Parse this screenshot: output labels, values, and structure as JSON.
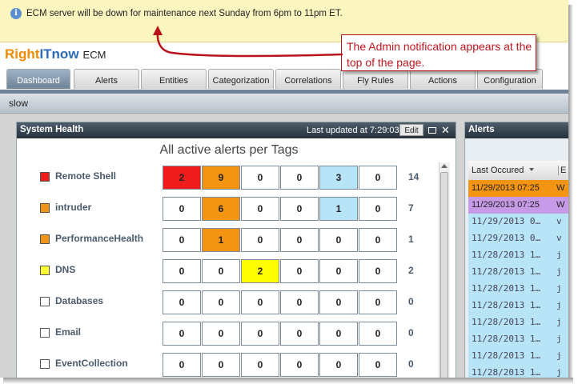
{
  "notification": {
    "message": "ECM server will be down for maintenance next Sunday from 6pm to 11pm ET."
  },
  "app": {
    "logo_part1": "Right",
    "logo_part2": "ITnow",
    "product": "ECM"
  },
  "tabs": [
    {
      "label": "Dashboard",
      "active": true
    },
    {
      "label": "Alerts"
    },
    {
      "label": "Entities"
    },
    {
      "label": "Categorization"
    },
    {
      "label": "Correlations"
    },
    {
      "label": "Fly Rules"
    },
    {
      "label": "Actions"
    },
    {
      "label": "Configuration"
    }
  ],
  "subbar": {
    "label": "slow"
  },
  "system_health": {
    "title": "System Health",
    "last_updated": "Last updated at 7:29:03",
    "edit_label": "Edit",
    "close_glyph": "✕",
    "chart_title": "All active alerts per Tags",
    "rows": [
      {
        "tag": "Remote Shell",
        "color": "#ee1c1c",
        "cells": [
          "2",
          "9",
          "0",
          "0",
          "3",
          "0"
        ],
        "total": "14"
      },
      {
        "tag": "intruder",
        "color": "#f39412",
        "cells": [
          "0",
          "6",
          "0",
          "0",
          "1",
          "0"
        ],
        "total": "7"
      },
      {
        "tag": "PerformanceHealth",
        "color": "#f39412",
        "cells": [
          "0",
          "1",
          "0",
          "0",
          "0",
          "0"
        ],
        "total": "1"
      },
      {
        "tag": "DNS",
        "color": "#ffff33",
        "cells": [
          "0",
          "0",
          "2",
          "0",
          "0",
          "0"
        ],
        "total": "2"
      },
      {
        "tag": "Databases",
        "color": "#ffffff",
        "cells": [
          "0",
          "0",
          "0",
          "0",
          "0",
          "0"
        ],
        "total": "0"
      },
      {
        "tag": "Email",
        "color": "#ffffff",
        "cells": [
          "0",
          "0",
          "0",
          "0",
          "0",
          "0"
        ],
        "total": "0"
      },
      {
        "tag": "EventCollection",
        "color": "#ffffff",
        "cells": [
          "0",
          "0",
          "0",
          "0",
          "0",
          "0"
        ],
        "total": "0"
      }
    ],
    "cell_colors": {
      "critical": "#ee1c1c",
      "major": "#f39412",
      "minor": "#ffff00",
      "info": "#b8e4f8",
      "none": "#ffffff"
    }
  },
  "alerts_panel": {
    "title": "Alerts",
    "col1": "Last Occured",
    "col2": "E",
    "rows": [
      {
        "date": "11/29/2013 07:25",
        "extra": "W",
        "bg": "#f39412",
        "mono": false
      },
      {
        "date": "11/29/2013 07:25",
        "extra": "W",
        "bg": "#c79ae8",
        "mono": false
      },
      {
        "date": "11/29/2013 0…",
        "extra": "v",
        "bg": "#b8e4f8",
        "mono": true
      },
      {
        "date": "11/29/2013 0…",
        "extra": "v",
        "bg": "#b8e4f8",
        "mono": true
      },
      {
        "date": "11/28/2013 1…",
        "extra": "j",
        "bg": "#b8e4f8",
        "mono": true
      },
      {
        "date": "11/28/2013 1…",
        "extra": "j",
        "bg": "#b8e4f8",
        "mono": true
      },
      {
        "date": "11/28/2013 1…",
        "extra": "j",
        "bg": "#b8e4f8",
        "mono": true
      },
      {
        "date": "11/28/2013 1…",
        "extra": "j",
        "bg": "#b8e4f8",
        "mono": true
      },
      {
        "date": "11/28/2013 1…",
        "extra": "j",
        "bg": "#b8e4f8",
        "mono": true
      },
      {
        "date": "11/28/2013 1…",
        "extra": "j",
        "bg": "#b8e4f8",
        "mono": true
      },
      {
        "date": "11/28/2013 1…",
        "extra": "j",
        "bg": "#b8e4f8",
        "mono": true
      },
      {
        "date": "11/28/2013 1…",
        "extra": "j",
        "bg": "#b8e4f8",
        "mono": true
      }
    ]
  },
  "callout": {
    "text": "The Admin notification appears at the top of the page."
  }
}
